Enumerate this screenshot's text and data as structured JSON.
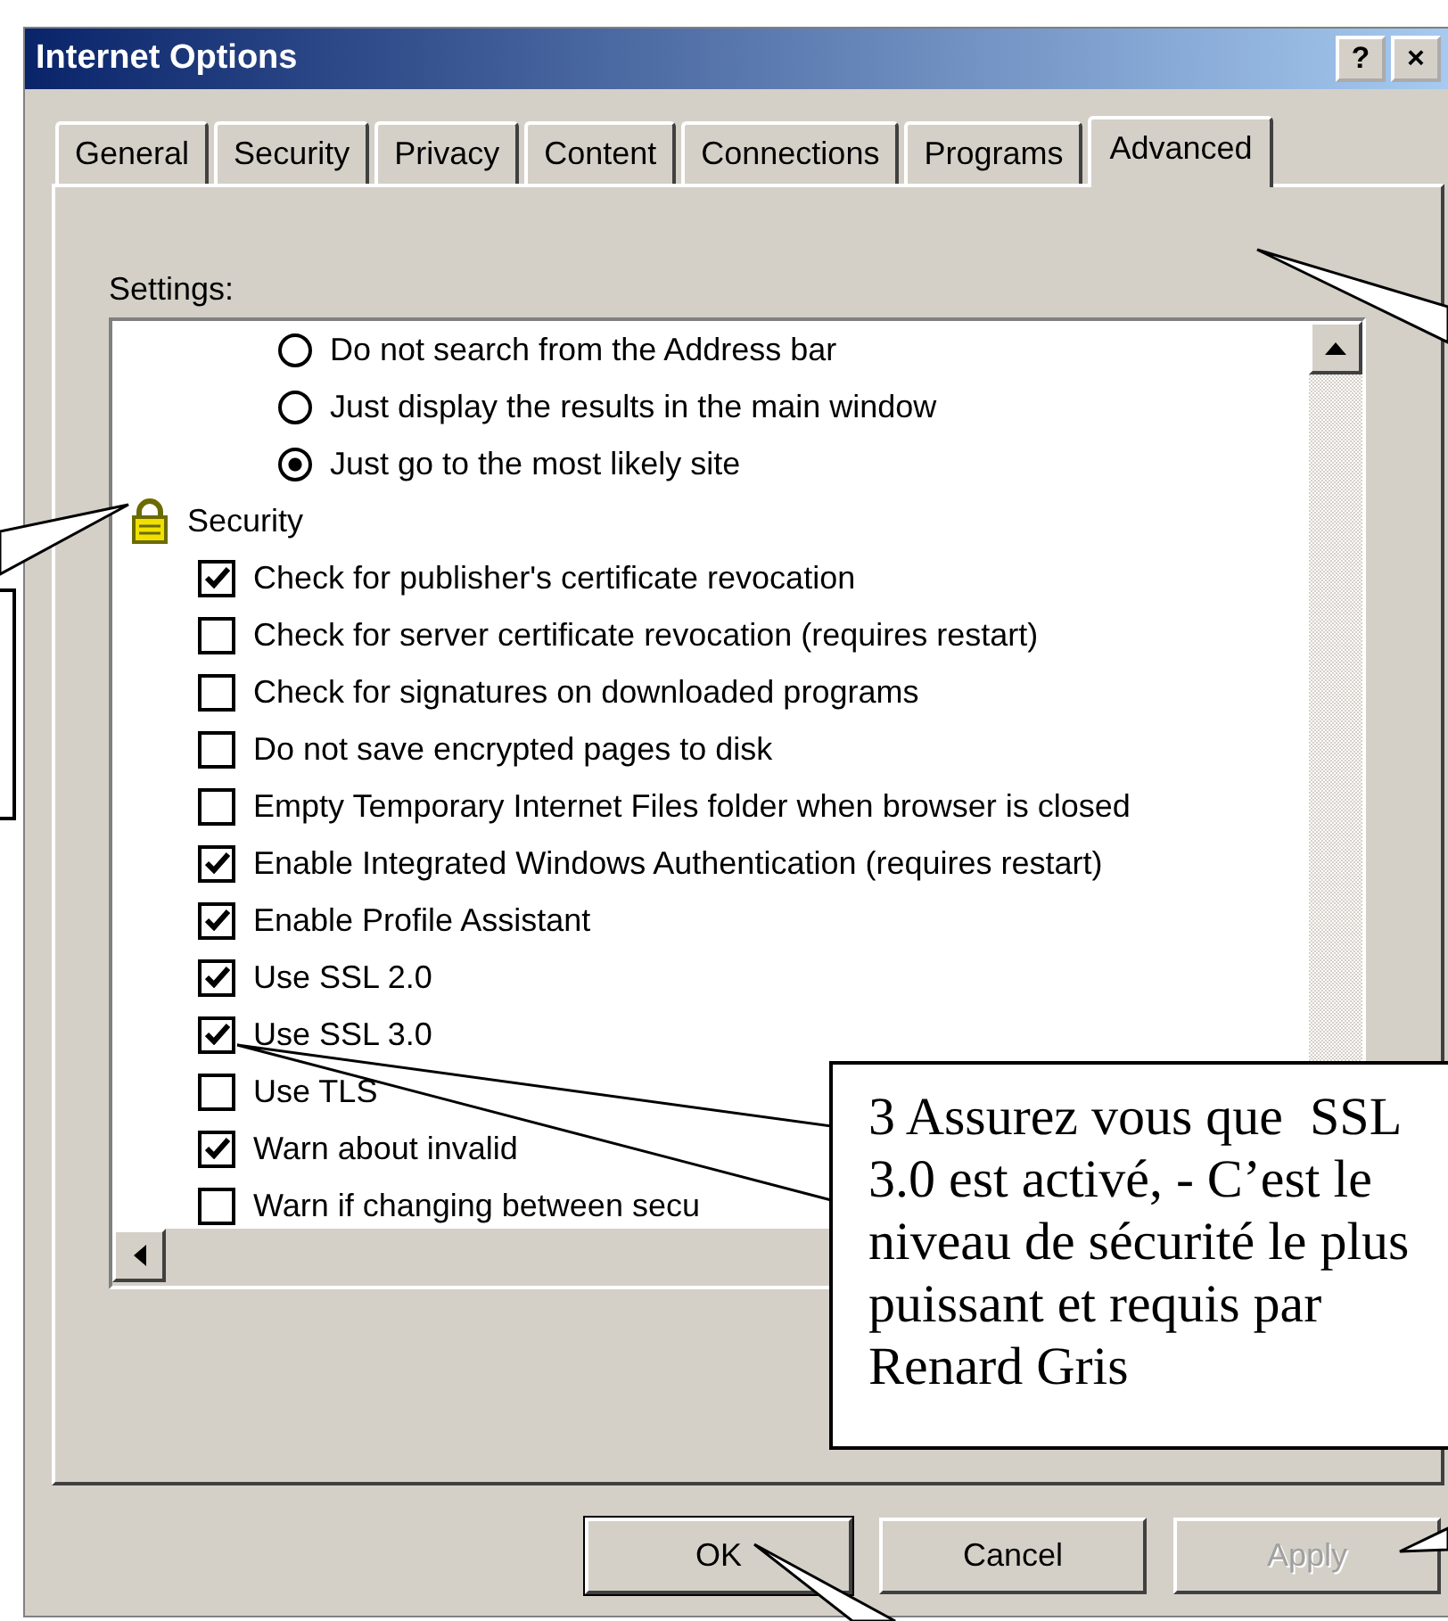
{
  "window": {
    "title": "Internet Options",
    "title_buttons": [
      "?",
      "×"
    ]
  },
  "tabs": [
    {
      "label": "General",
      "selected": false
    },
    {
      "label": "Security",
      "selected": false
    },
    {
      "label": "Privacy",
      "selected": false
    },
    {
      "label": "Content",
      "selected": false
    },
    {
      "label": "Connections",
      "selected": false
    },
    {
      "label": "Programs",
      "selected": false
    },
    {
      "label": "Advanced",
      "selected": true
    }
  ],
  "settings_label": "Settings:",
  "settings": [
    {
      "kind": "radio",
      "label": "Do not search from the Address bar",
      "selected": false
    },
    {
      "kind": "radio",
      "label": "Just display the results in the main window",
      "selected": false
    },
    {
      "kind": "radio",
      "label": "Just go to the most likely site",
      "selected": true
    },
    {
      "kind": "group",
      "label": "Security",
      "children": [
        {
          "kind": "checkbox",
          "label": "Check for publisher's certificate revocation",
          "checked": true
        },
        {
          "kind": "checkbox",
          "label": "Check for server certificate revocation (requires restart)",
          "checked": false
        },
        {
          "kind": "checkbox",
          "label": "Check for signatures on downloaded programs",
          "checked": false
        },
        {
          "kind": "checkbox",
          "label": "Do not save encrypted pages to disk",
          "checked": false
        },
        {
          "kind": "checkbox",
          "label": "Empty Temporary Internet Files folder when browser is closed",
          "checked": false
        },
        {
          "kind": "checkbox",
          "label": "Enable Integrated Windows Authentication (requires restart)",
          "checked": true
        },
        {
          "kind": "checkbox",
          "label": "Enable Profile Assistant",
          "checked": true
        },
        {
          "kind": "checkbox",
          "label": "Use SSL 2.0",
          "checked": true
        },
        {
          "kind": "checkbox",
          "label": "Use SSL 3.0",
          "checked": true
        },
        {
          "kind": "checkbox",
          "label": "Use TLS",
          "checked": false
        },
        {
          "kind": "checkbox",
          "label": "Warn about invalid",
          "checked": true
        },
        {
          "kind": "checkbox",
          "label": "Warn if changing between secu",
          "checked": false
        }
      ]
    }
  ],
  "buttons": [
    {
      "label": "OK",
      "default": true,
      "disabled": false
    },
    {
      "label": "Cancel",
      "default": false,
      "disabled": false
    },
    {
      "label": "Apply",
      "default": false,
      "disabled": true
    }
  ],
  "annotations": [
    {
      "kind": "empty-callout"
    },
    {
      "kind": "callout",
      "text": "3 Assurez vous que  SSL 3.0 est activé, - C’est le niveau de sécurité le plus puissant et requis par Renard Gris"
    }
  ]
}
